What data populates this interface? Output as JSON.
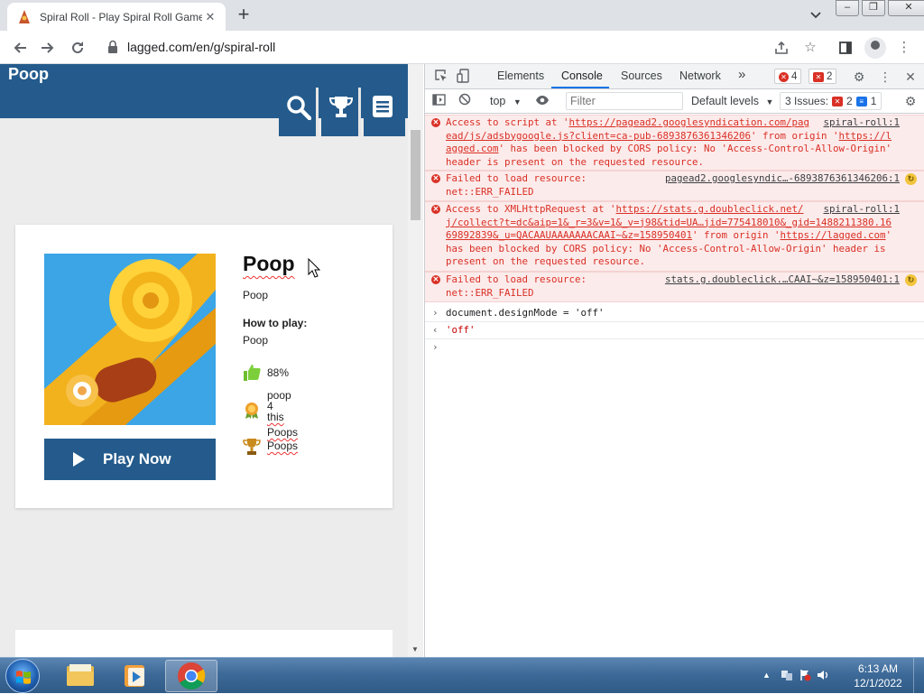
{
  "browser": {
    "tab_title": "Spiral Roll - Play Spiral Roll Game",
    "tab_close": "✕",
    "new_tab": "+",
    "url": "lagged.com/en/g/spiral-roll"
  },
  "site": {
    "header_title": "Poop",
    "game": {
      "title": "Poop",
      "description": "Poop",
      "howto_heading": "How to play:",
      "howto_text": "Poop",
      "rating": "88%",
      "award_line1": "poop",
      "award_line2": "4",
      "award_line3": "this",
      "award_line4": "Poops",
      "trophy_text": "Poops",
      "play_label": "Play Now"
    }
  },
  "devtools": {
    "tabs": [
      "Elements",
      "Console",
      "Sources",
      "Network"
    ],
    "more_tabs": "»",
    "error_count": "4",
    "issue_badge_count": "2",
    "context": "top",
    "filter_placeholder": "Filter",
    "levels": "Default levels",
    "issues_label": "3 Issues:",
    "issues_errors": "2",
    "issues_info": "1",
    "messages": [
      {
        "type": "error",
        "text_a": "Access to script at '",
        "link_a": "https://pagead2.googlesyndication.com/pag\nead/js/adsbygoogle.js?client=ca-pub-6893876361346206",
        "text_b": "' from origin '",
        "link_b": "https://l\nagged.com",
        "text_c": "' has been blocked by CORS policy: No 'Access-Control-Allow-Origin'\nheader is present on the requested resource.",
        "source": "spiral-roll:1"
      },
      {
        "type": "error",
        "text": "Failed to load resource:\nnet::ERR_FAILED",
        "source": "pagead2.googlesyndic…-6893876361346206:1"
      },
      {
        "type": "error",
        "text_a": "Access to XMLHttpRequest at '",
        "link_a": "https://stats.g.doubleclick.net/\nj/collect?t=dc&aip=1&_r=3&v=1&_v=j98&tid=UA…jid=775418010&_gid=1488211380.16\n69892839&_u=QACAAUAAAAAAACAAI~&z=158950401",
        "text_b": "' from origin '",
        "link_b": "https://lagged.com",
        "text_c": "'\nhas been blocked by CORS policy: No 'Access-Control-Allow-Origin' header is\npresent on the requested resource.",
        "source": "spiral-roll:1"
      },
      {
        "type": "error",
        "text": "Failed to load resource:\nnet::ERR_FAILED",
        "source": "stats.g.doubleclick.…CAAI~&z=158950401:1"
      }
    ],
    "command": "document.designMode = 'off'",
    "result": "'off'",
    "prompt_chevron": "›",
    "result_chevron": "‹"
  },
  "taskbar": {
    "time": "6:13 AM",
    "date": "12/1/2022"
  },
  "colors": {
    "site_blue": "#245b8c",
    "error_red": "#d93025",
    "devtools_accent": "#1a73e8"
  },
  "icons": [
    "back-icon",
    "forward-icon",
    "reload-icon",
    "lock-icon",
    "share-icon",
    "star-icon",
    "side-panel-icon",
    "profile-icon",
    "menu-dots-icon",
    "search-icon",
    "trophy-icon",
    "menu-icon",
    "thumbs-up-icon",
    "award-icon",
    "inspect-icon",
    "device-icon",
    "gear-icon",
    "close-icon",
    "sidebar-icon",
    "clear-icon",
    "eye-icon"
  ]
}
